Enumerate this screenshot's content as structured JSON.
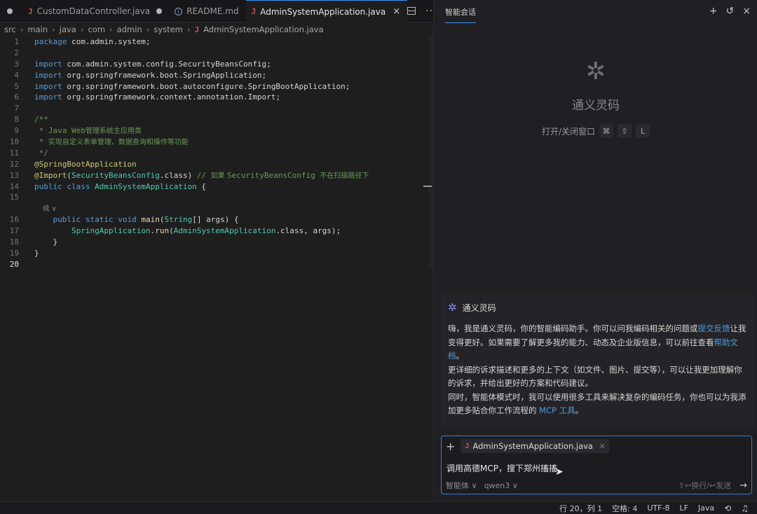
{
  "editor": {
    "tabs": [
      {
        "label": "CustomDataController.java",
        "icon": "java-file-icon",
        "modified": true,
        "active": false
      },
      {
        "label": "README.md",
        "icon": "info-file-icon",
        "modified": false,
        "active": false
      },
      {
        "label": "AdminSystemApplication.java",
        "icon": "java-file-icon",
        "modified": false,
        "active": true
      }
    ],
    "breadcrumb": [
      "src",
      "main",
      "java",
      "com",
      "admin",
      "system",
      "AdminSystemApplication.java"
    ],
    "code_lines": [
      {
        "n": "1",
        "tokens": [
          [
            "kw",
            "package"
          ],
          [
            "",
            " com.admin.system;"
          ]
        ]
      },
      {
        "n": "2",
        "tokens": []
      },
      {
        "n": "3",
        "tokens": [
          [
            "kw",
            "import"
          ],
          [
            "",
            " com.admin.system.config.SecurityBeansConfig;"
          ]
        ]
      },
      {
        "n": "4",
        "tokens": [
          [
            "kw",
            "import"
          ],
          [
            "",
            " org.springframework.boot.SpringApplication;"
          ]
        ]
      },
      {
        "n": "5",
        "tokens": [
          [
            "kw",
            "import"
          ],
          [
            "",
            " org.springframework.boot.autoconfigure.SpringBootApplication;"
          ]
        ]
      },
      {
        "n": "6",
        "tokens": [
          [
            "kw",
            "import"
          ],
          [
            "",
            " org.springframework.context.annotation.Import;"
          ]
        ]
      },
      {
        "n": "7",
        "tokens": []
      },
      {
        "n": "8",
        "tokens": [
          [
            "cm",
            "/**"
          ]
        ]
      },
      {
        "n": "9",
        "tokens": [
          [
            "cm",
            " * Java Web"
          ],
          [
            "cmcn",
            "管理系统主应用类"
          ]
        ]
      },
      {
        "n": "10",
        "tokens": [
          [
            "cm",
            " * "
          ],
          [
            "cmcn",
            "实现自定义表单管理、数据查询和操作等功能"
          ]
        ]
      },
      {
        "n": "11",
        "tokens": [
          [
            "cm",
            " */"
          ]
        ]
      },
      {
        "n": "12",
        "tokens": [
          [
            "an",
            "@SpringBootApplication"
          ]
        ]
      },
      {
        "n": "13",
        "tokens": [
          [
            "an",
            "@Import"
          ],
          [
            "",
            "("
          ],
          [
            "ty",
            "SecurityBeansConfig"
          ],
          [
            "",
            ".class) "
          ],
          [
            "cm",
            "// "
          ],
          [
            "cmcn",
            "如果 "
          ],
          [
            "cm",
            "SecurityBeansConfig "
          ],
          [
            "cmcn",
            "不在扫描路径下"
          ]
        ]
      },
      {
        "n": "14",
        "tokens": [
          [
            "kw",
            "public class "
          ],
          [
            "ty",
            "AdminSystemApplication"
          ],
          [
            "",
            " {"
          ]
        ]
      },
      {
        "n": "15",
        "tokens": []
      },
      {
        "n": "",
        "tokens": [
          [
            "hint",
            "    续 ∨"
          ]
        ]
      },
      {
        "n": "16",
        "tokens": [
          [
            "",
            "    "
          ],
          [
            "kw",
            "public static void "
          ],
          [
            "fn",
            "main"
          ],
          [
            "",
            "("
          ],
          [
            "ty",
            "String"
          ],
          [
            "",
            "[] args) {"
          ]
        ]
      },
      {
        "n": "17",
        "tokens": [
          [
            "",
            "        "
          ],
          [
            "ty",
            "SpringApplication"
          ],
          [
            "",
            "."
          ],
          [
            "fn",
            "run"
          ],
          [
            "",
            "("
          ],
          [
            "ty",
            "AdminSystemApplication"
          ],
          [
            "",
            ".class, args);"
          ]
        ]
      },
      {
        "n": "18",
        "tokens": [
          [
            "",
            "    }"
          ]
        ]
      },
      {
        "n": "19",
        "tokens": [
          [
            "",
            "}"
          ]
        ]
      },
      {
        "n": "20",
        "tokens": [],
        "current": true
      }
    ]
  },
  "chat": {
    "header_title": "智能会话",
    "header_icons": [
      "plus-icon",
      "history-icon",
      "close-icon"
    ],
    "welcome": {
      "name": "通义灵码",
      "shortcut_label": "打开/关闭窗口",
      "keys": [
        "⌘",
        "⇧",
        "L"
      ]
    },
    "message": {
      "sender": "通义灵码",
      "p1_a": "嗨，我是通义灵码，你的智能编码助手。你可以问我编码相关的问题或",
      "p1_link1": "提交反馈",
      "p1_b": "让我变得更好。如果需要了解更多我的能力、动态及企业版信息，可以前往查看",
      "p1_link2": "帮助文档",
      "p1_c": "。",
      "p2": "更详细的诉求描述和更多的上下文（如文件、图片、提交等），可以让我更加理解你的诉求，并给出更好的方案和代码建议。",
      "p3_a": "同时，智能体模式时，我可以使用很多工具来解决复杂的编码任务，你也可以为我添加更多贴合你工作流程的 ",
      "p3_link": "MCP 工具",
      "p3_b": "。"
    },
    "input": {
      "context_file": "AdminSystemApplication.java",
      "text": "调用高德MCP，搜下郑州搐搐",
      "mode": "智能体 ∨",
      "model": "qwen3 ∨",
      "send_hint": "⇧↩换行/↩发送"
    }
  },
  "statusbar": {
    "position": "行 20，列 1",
    "spaces": "空格: 4",
    "encoding": "UTF-8",
    "eol": "LF",
    "language": "Java"
  },
  "colors": {
    "accent": "#3794ff",
    "link": "#4d9de0",
    "java_icon": "#e0484a"
  }
}
